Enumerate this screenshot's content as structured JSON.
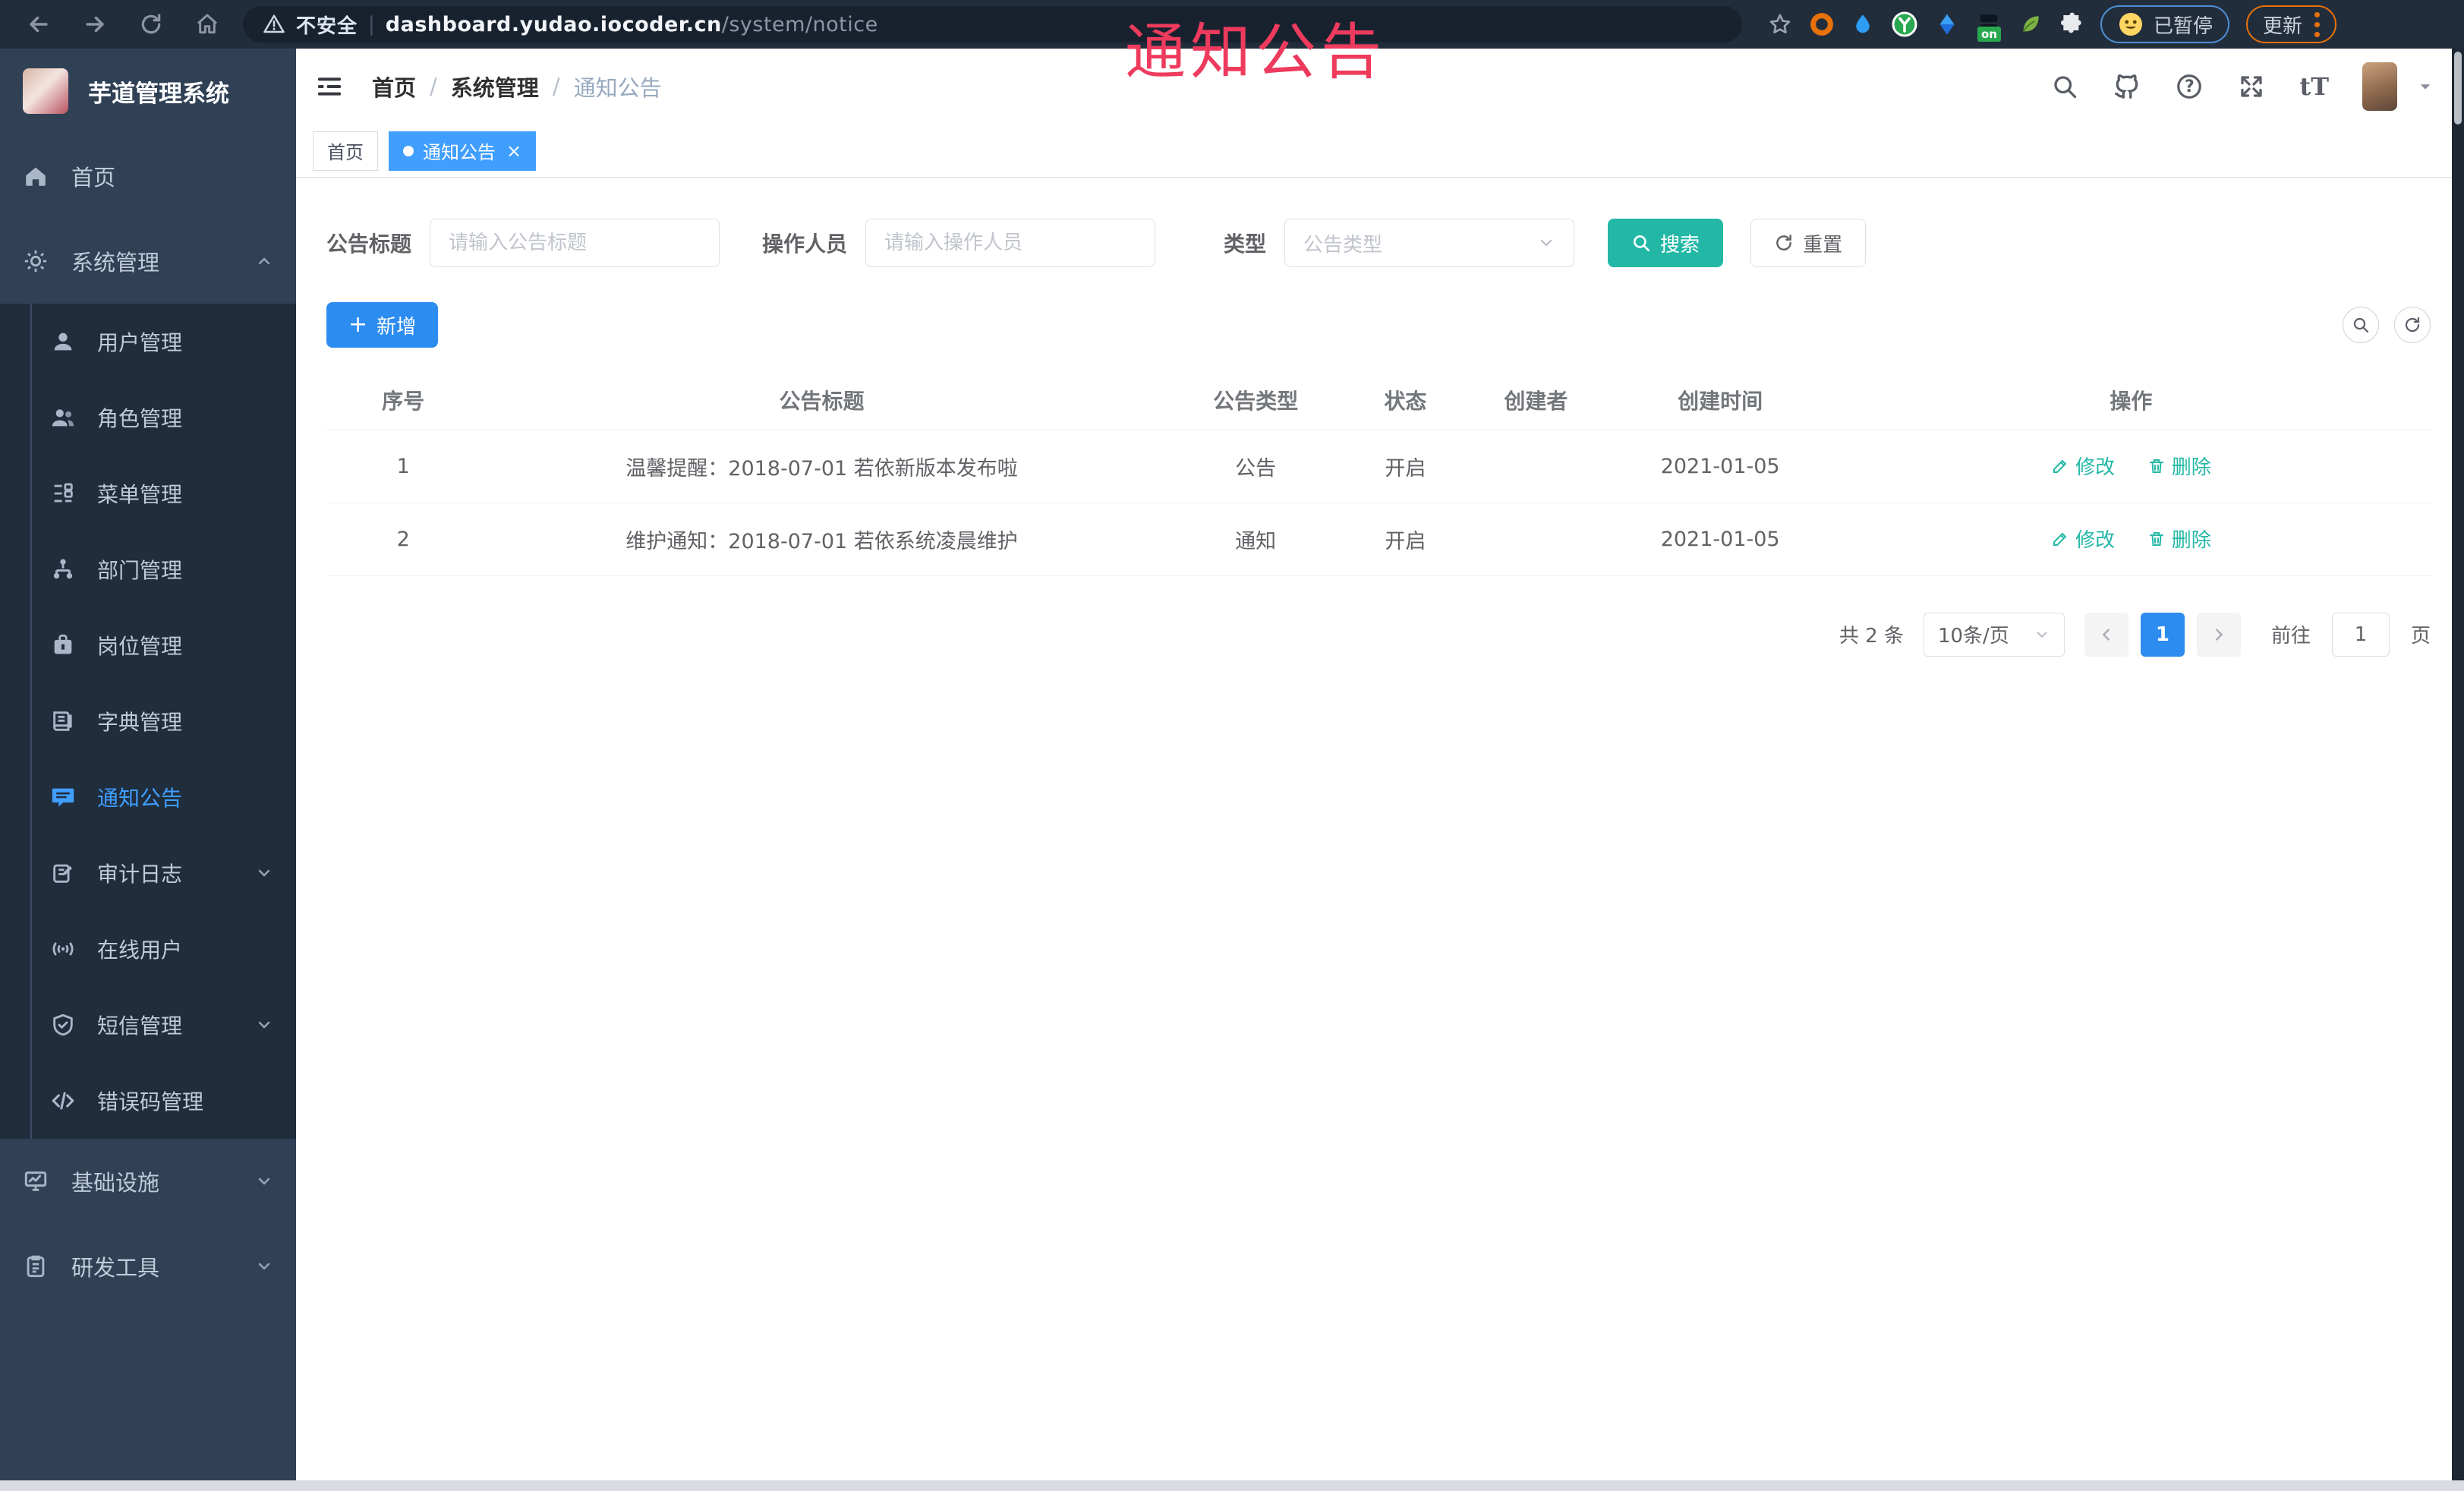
{
  "browser": {
    "security_label": "不安全",
    "url_host": "dashboard.yudao.iocoder.cn",
    "url_path": "/system/notice",
    "paused_label": "已暂停",
    "update_label": "更新",
    "on_badge": "on"
  },
  "overlay_annotation": {
    "text": "通知公告"
  },
  "sidebar": {
    "title": "芋道管理系统",
    "items": [
      {
        "label": "首页",
        "icon": "home-icon"
      },
      {
        "label": "系统管理",
        "icon": "gear-icon"
      },
      {
        "label": "用户管理",
        "icon": "user-icon"
      },
      {
        "label": "角色管理",
        "icon": "users-icon"
      },
      {
        "label": "菜单管理",
        "icon": "menu-list-icon"
      },
      {
        "label": "部门管理",
        "icon": "org-tree-icon"
      },
      {
        "label": "岗位管理",
        "icon": "briefcase-icon"
      },
      {
        "label": "字典管理",
        "icon": "book-icon"
      },
      {
        "label": "通知公告",
        "icon": "megaphone-icon"
      },
      {
        "label": "审计日志",
        "icon": "log-icon"
      },
      {
        "label": "在线用户",
        "icon": "online-users-icon"
      },
      {
        "label": "短信管理",
        "icon": "shield-icon"
      },
      {
        "label": "错误码管理",
        "icon": "code-icon"
      },
      {
        "label": "基础设施",
        "icon": "monitor-icon"
      },
      {
        "label": "研发工具",
        "icon": "tool-icon"
      }
    ]
  },
  "header": {
    "breadcrumb": {
      "home": "首页",
      "section": "系统管理",
      "current": "通知公告",
      "separator": "/"
    },
    "icons": {
      "help_glyph": "?",
      "text_size_glyph": "tT"
    }
  },
  "tabs": {
    "home": "首页",
    "current": "通知公告",
    "close_glyph": "×"
  },
  "filters": {
    "title_label": "公告标题",
    "title_placeholder": "请输入公告标题",
    "operator_label": "操作人员",
    "operator_placeholder": "请输入操作人员",
    "type_label": "类型",
    "type_placeholder": "公告类型",
    "search_label": "搜索",
    "reset_label": "重置"
  },
  "toolbar": {
    "add_label": "新增",
    "plus_glyph": "+"
  },
  "table": {
    "columns": [
      "序号",
      "公告标题",
      "公告类型",
      "状态",
      "创建者",
      "创建时间",
      "操作"
    ],
    "rows": [
      {
        "index": "1",
        "title": "温馨提醒：2018-07-01 若依新版本发布啦",
        "type": "公告",
        "status": "开启",
        "creator": "",
        "created_at": "2021-01-05"
      },
      {
        "index": "2",
        "title": "维护通知：2018-07-01 若依系统凌晨维护",
        "type": "通知",
        "status": "开启",
        "creator": "",
        "created_at": "2021-01-05"
      }
    ],
    "edit_label": "修改",
    "delete_label": "删除"
  },
  "pagination": {
    "total_text": "共 2 条",
    "page_size": "10条/页",
    "current_page": "1",
    "goto_label": "前往",
    "goto_value": "1",
    "page_unit": "页"
  }
}
